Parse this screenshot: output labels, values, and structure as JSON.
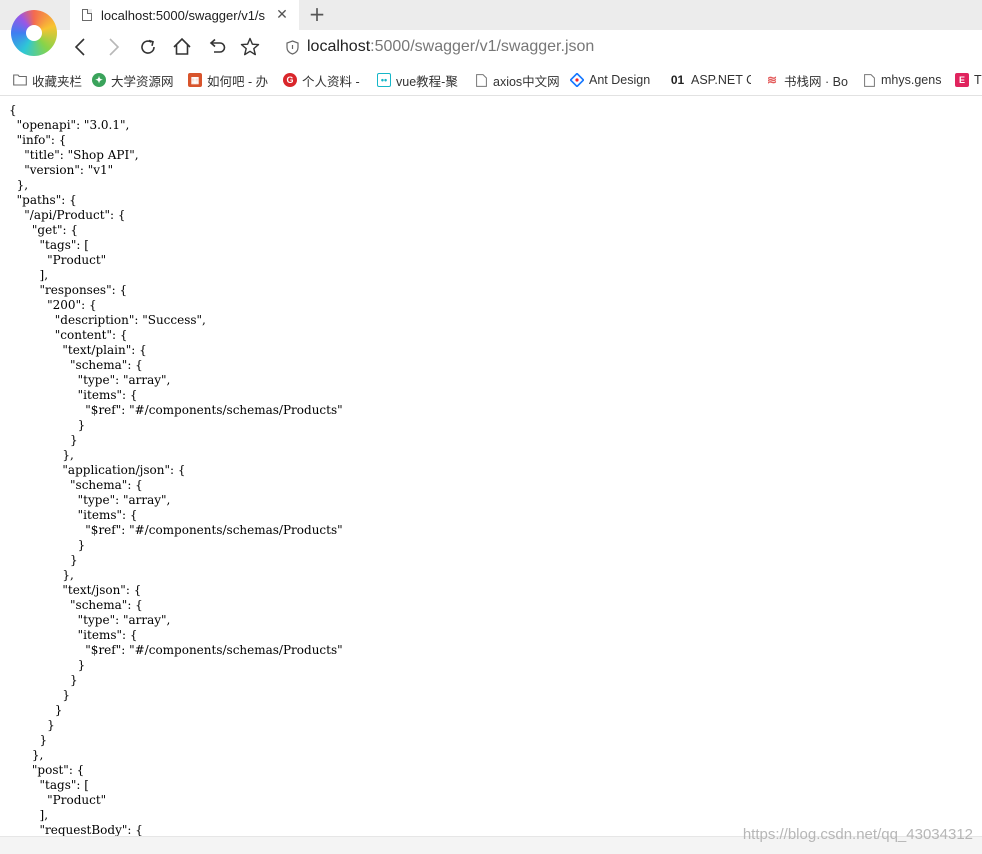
{
  "tab": {
    "title": "localhost:5000/swagger/v1/s",
    "close_glyph": "✕",
    "new_tab_glyph": "+"
  },
  "address": {
    "host": "localhost",
    "rest": ":5000/swagger/v1/swagger.json"
  },
  "bookmarks": [
    {
      "label": "收藏夹栏",
      "icon": "folder-icon",
      "color": "#8a8a8a"
    },
    {
      "label": "大学资源网",
      "icon": "dxzy-icon",
      "color": "#3aa35b"
    },
    {
      "label": "如何吧 - 办",
      "icon": "ruheba-icon",
      "color": "#d8542c"
    },
    {
      "label": "个人资料 -",
      "icon": "gerenziliao-icon",
      "color": "#d9262b"
    },
    {
      "label": "vue教程-聚",
      "icon": "vue-icon",
      "color": "#15b6c8"
    },
    {
      "label": "axios中文网",
      "icon": "page-icon",
      "color": "#8a8a8a"
    },
    {
      "label": "Ant Design",
      "icon": "antdesign-icon",
      "color": "#1677ff"
    },
    {
      "label": "ASP.NET C",
      "icon": "aspnet-icon",
      "color": "#222222"
    },
    {
      "label": "书栈网 · Bo",
      "icon": "shuzhan-icon",
      "color": "#e35b5b"
    },
    {
      "label": "mhys.gens",
      "icon": "page-icon",
      "color": "#8a8a8a"
    },
    {
      "label": "T",
      "icon": "t-icon",
      "color": "#e0245e"
    }
  ],
  "json_text": "{\n  \"openapi\": \"3.0.1\",\n  \"info\": {\n    \"title\": \"Shop API\",\n    \"version\": \"v1\"\n  },\n  \"paths\": {\n    \"/api/Product\": {\n      \"get\": {\n        \"tags\": [\n          \"Product\"\n        ],\n        \"responses\": {\n          \"200\": {\n            \"description\": \"Success\",\n            \"content\": {\n              \"text/plain\": {\n                \"schema\": {\n                  \"type\": \"array\",\n                  \"items\": {\n                    \"$ref\": \"#/components/schemas/Products\"\n                  }\n                }\n              },\n              \"application/json\": {\n                \"schema\": {\n                  \"type\": \"array\",\n                  \"items\": {\n                    \"$ref\": \"#/components/schemas/Products\"\n                  }\n                }\n              },\n              \"text/json\": {\n                \"schema\": {\n                  \"type\": \"array\",\n                  \"items\": {\n                    \"$ref\": \"#/components/schemas/Products\"\n                  }\n                }\n              }\n            }\n          }\n        }\n      },\n      \"post\": {\n        \"tags\": [\n          \"Product\"\n        ],\n        \"requestBody\": {",
  "watermark": "https://blog.csdn.net/qq_43034312",
  "colors": {
    "tab_bar": "#ececec",
    "active_tab": "#ffffff",
    "url_host": "#222222",
    "url_rest": "#777777"
  }
}
